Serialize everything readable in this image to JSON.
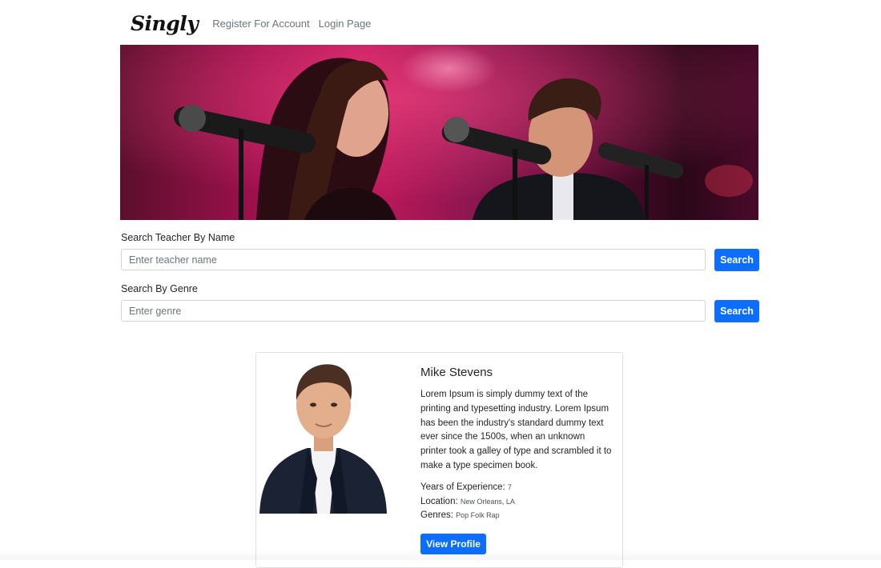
{
  "navbar": {
    "brand": "Singly",
    "links": [
      "Register For Account",
      "Login Page"
    ]
  },
  "search": {
    "name": {
      "label": "Search Teacher By Name",
      "placeholder": "Enter teacher name",
      "button": "Search"
    },
    "genre": {
      "label": "Search By Genre",
      "placeholder": "Enter genre",
      "button": "Search"
    }
  },
  "teacher": {
    "name": "Mike Stevens",
    "bio": "Lorem Ipsum is simply dummy text of the printing and typesetting industry. Lorem Ipsum has been the industry's standard dummy text ever since the 1500s, when an unknown printer took a galley of type and scrambled it to make a type specimen book.",
    "experience_label": "Years of Experience:",
    "experience": "7",
    "location_label": "Location:",
    "location": "New Orleans, LA",
    "genres_label": "Genres:",
    "genres": "Pop Folk Rap",
    "button": "View Profile"
  },
  "colors": {
    "primary": "#0d6efd",
    "hero_accent": "#c2185b"
  }
}
